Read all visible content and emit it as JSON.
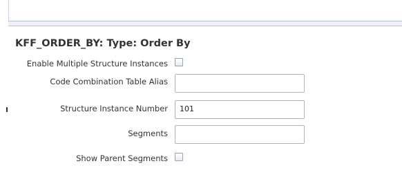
{
  "header": {
    "title": "KFF_ORDER_BY: Type: Order By"
  },
  "form": {
    "enable_multiple": {
      "label": "Enable Multiple Structure Instances",
      "checked": false
    },
    "code_combination_alias": {
      "label": "Code Combination Table Alias",
      "value": ""
    },
    "structure_instance_number": {
      "label": "Structure Instance Number",
      "value": "101"
    },
    "segments": {
      "label": "Segments",
      "value": ""
    },
    "show_parent_segments": {
      "label": "Show Parent Segments",
      "checked": false
    }
  }
}
